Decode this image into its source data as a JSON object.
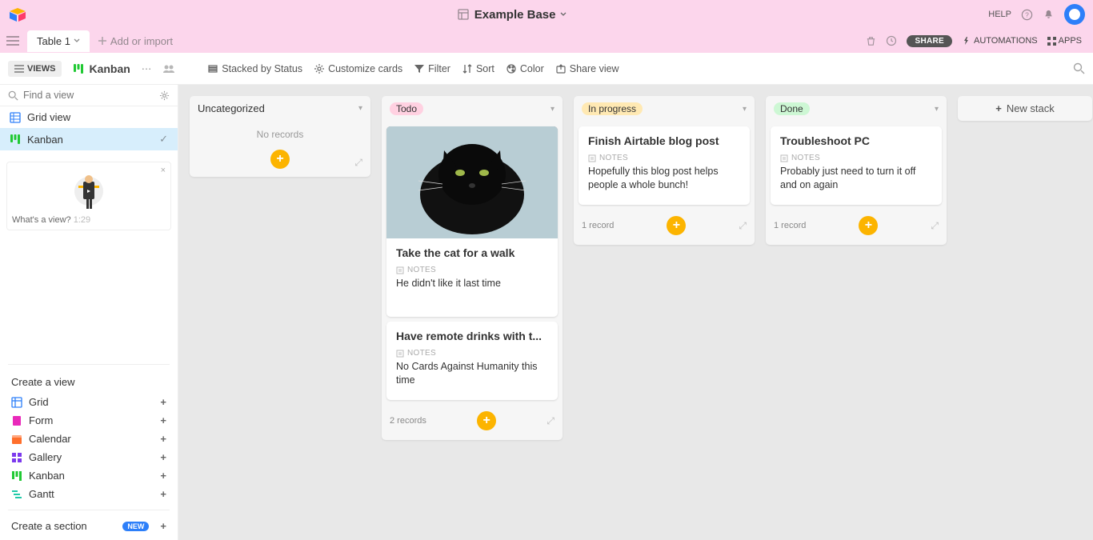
{
  "header": {
    "base_name": "Example Base",
    "help": "HELP"
  },
  "tabs": {
    "active": "Table 1",
    "add": "Add or import",
    "share": "SHARE",
    "automations": "AUTOMATIONS",
    "apps": "APPS"
  },
  "toolbar": {
    "views": "VIEWS",
    "view_name": "Kanban",
    "stacked": "Stacked by Status",
    "customize": "Customize cards",
    "filter": "Filter",
    "sort": "Sort",
    "color": "Color",
    "share_view": "Share view"
  },
  "sidebar": {
    "find_placeholder": "Find a view",
    "views": [
      {
        "name": "Grid view",
        "icon": "grid"
      },
      {
        "name": "Kanban",
        "icon": "kanban"
      }
    ],
    "promo_text": "What's a view?",
    "promo_time": "1:29",
    "create_title": "Create a view",
    "create_items": [
      {
        "name": "Grid",
        "color": "#2d7ff9"
      },
      {
        "name": "Form",
        "color": "#e929ba"
      },
      {
        "name": "Calendar",
        "color": "#ff6f2c"
      },
      {
        "name": "Gallery",
        "color": "#7c39ed"
      },
      {
        "name": "Kanban",
        "color": "#20c933"
      },
      {
        "name": "Gantt",
        "color": "#20c9a8"
      }
    ],
    "create_section": "Create a section",
    "new_badge": "NEW"
  },
  "board": {
    "stacks": [
      {
        "title": "Uncategorized",
        "pill_bg": "",
        "empty_text": "No records",
        "count": "",
        "cards": []
      },
      {
        "title": "Todo",
        "pill_bg": "#ffd1e1",
        "count": "2 records",
        "cards": [
          {
            "title": "Take the cat for a walk",
            "notes_label": "NOTES",
            "notes": "He didn't like it last time",
            "has_image": true
          },
          {
            "title": "Have remote drinks with t...",
            "notes_label": "NOTES",
            "notes": "No Cards Against Humanity this time"
          }
        ]
      },
      {
        "title": "In progress",
        "pill_bg": "#ffe9b3",
        "count": "1 record",
        "cards": [
          {
            "title": "Finish Airtable blog post",
            "notes_label": "NOTES",
            "notes": "Hopefully this blog post helps people a whole bunch!"
          }
        ]
      },
      {
        "title": "Done",
        "pill_bg": "#cdf7d4",
        "count": "1 record",
        "cards": [
          {
            "title": "Troubleshoot PC",
            "notes_label": "NOTES",
            "notes": "Probably just need to turn it off and on again"
          }
        ]
      }
    ],
    "new_stack": "New stack"
  }
}
